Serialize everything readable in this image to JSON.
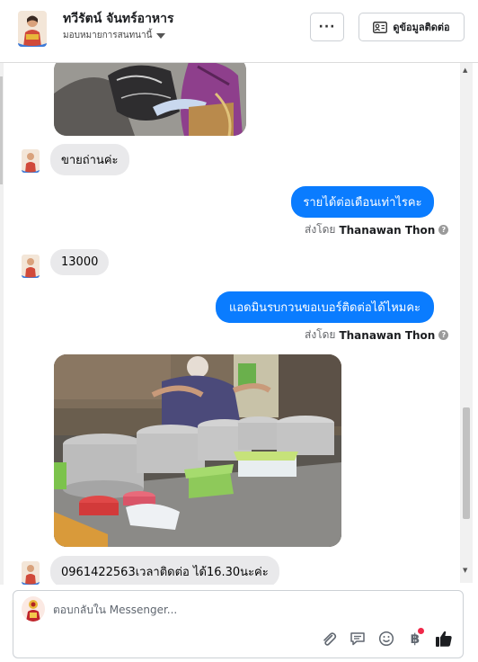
{
  "header": {
    "contact_name": "ทวีรัตน์ จันทร์อาหาร",
    "assign_label": "มอบหมายการสนทนานี้",
    "more_label": "···",
    "contact_info_label": "ดูข้อมูลติดต่อ"
  },
  "messages": [
    {
      "type": "photo",
      "direction": "in",
      "content": "bag photo"
    },
    {
      "type": "text",
      "direction": "in",
      "text": "ขายถ่านค่ะ"
    },
    {
      "type": "text",
      "direction": "out",
      "text": "รายได้ต่อเดือนเท่าไรคะ",
      "sent_by_prefix": "ส่งโดย",
      "sent_by_name": "Thanawan Thon"
    },
    {
      "type": "text",
      "direction": "in",
      "text": "13000"
    },
    {
      "type": "text",
      "direction": "out",
      "text": "แอดมินรบกวนขอเบอร์ติดต่อได้ไหมคะ",
      "sent_by_prefix": "ส่งโดย",
      "sent_by_name": "Thanawan Thon"
    },
    {
      "type": "photo",
      "direction": "in",
      "content": "food stall photo"
    },
    {
      "type": "text",
      "direction": "in",
      "text": "0961422563เวลาติดต่อ ได้16.30นะค่ะ"
    }
  ],
  "composer": {
    "placeholder": "ตอบกลับใน Messenger..."
  },
  "icons": [
    "more-icon",
    "contact-card-icon",
    "attachment-icon",
    "saved-reply-icon",
    "emoji-icon",
    "payment-icon",
    "like-icon"
  ],
  "colors": {
    "outgoing_bubble": "#0a7cff",
    "incoming_bubble": "#e9e9eb",
    "like": "#1c1e21"
  }
}
